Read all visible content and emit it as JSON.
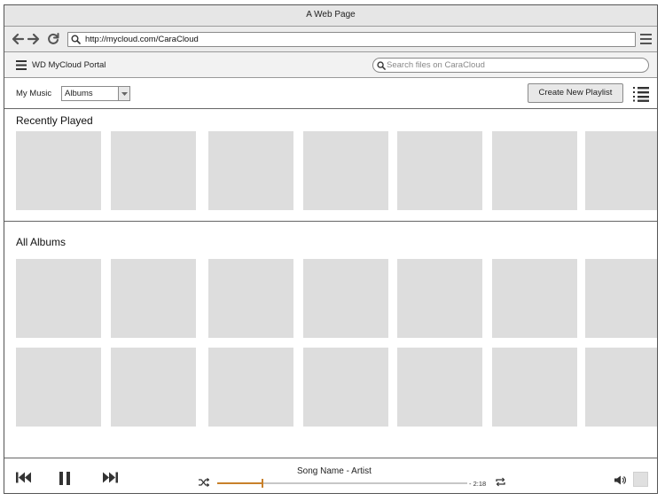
{
  "window": {
    "title": "A Web Page"
  },
  "browser": {
    "url": "http://mycloud.com/CaraCloud",
    "icons": [
      "back-arrow-icon",
      "forward-arrow-icon",
      "reload-icon",
      "search-icon",
      "hamburger-menu-icon"
    ]
  },
  "portal": {
    "title": "WD MyCloud Portal",
    "search_placeholder": "Search files on CaraCloud"
  },
  "toolbar": {
    "my_music_label": "My Music",
    "view_select_value": "Albums",
    "create_playlist_label": "Create New Playlist"
  },
  "recently_played": {
    "title": "Recently Played",
    "tiles": 7
  },
  "all_albums": {
    "title": "All Albums",
    "rows": 2,
    "tiles_per_row": 7
  },
  "player": {
    "song": "Song Name - Artist",
    "time_remaining": "- 2:18",
    "progress": 0.18,
    "accent_color": "#c8802a"
  }
}
